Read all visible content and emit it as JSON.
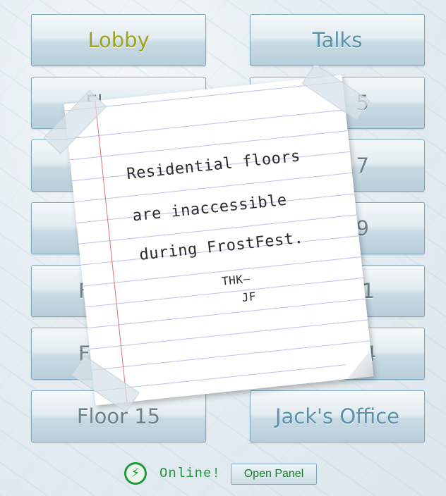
{
  "buttons": {
    "lobby": "Lobby",
    "talks": "Talks",
    "row2_left": "Fl",
    "row2_right": "5",
    "row3_right": "7",
    "row4_right": "9",
    "row5_left": "F",
    "row5_right": "1",
    "row6_left": "F",
    "row6_right": "4",
    "floor15": "Floor 15",
    "jacks_office": "Jack's Office"
  },
  "note": {
    "line1": "Residential floors",
    "line2": "are inaccessible",
    "line3": "during FrostFest.",
    "sig1": "THK—",
    "sig2": "JF"
  },
  "status": {
    "online_label": "Online!",
    "power_icon": "power-bolt-icon",
    "accent_color": "#1f9a3a"
  },
  "panel_button": "Open Panel"
}
